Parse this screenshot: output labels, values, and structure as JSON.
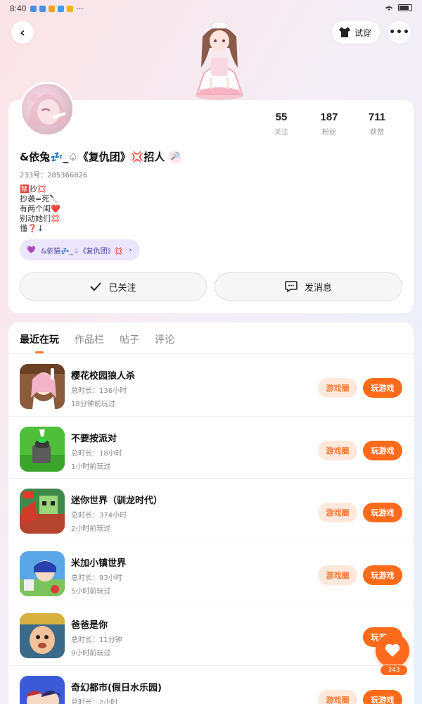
{
  "status_bar": {
    "time": "8:40",
    "more": "···"
  },
  "topbar": {
    "back_icon": "‹",
    "try_on_label": "试穿",
    "more_label": "•••"
  },
  "profile": {
    "stats": [
      {
        "value": "55",
        "label": "关注"
      },
      {
        "value": "187",
        "label": "粉丝"
      },
      {
        "value": "711",
        "label": "获赞"
      }
    ],
    "nickname": "&依兔💤_♤《复仇团》💢招人",
    "search_icon": "🔎",
    "uid": "233号：285366826",
    "bio": "🈲抄💢\n抄袭=死🔪\n有两个闺❤️\n别动她们💢\n懂❓↓",
    "group_tag": "&依猫💤_♤《复仇团》💢",
    "group_icon": "💜",
    "group_chevron": "›",
    "follow_label": "已关注",
    "message_label": "发消息"
  },
  "tabs": [
    "最近在玩",
    "作品栏",
    "帖子",
    "评论"
  ],
  "games": [
    {
      "name": "樱花校园狼人杀",
      "duration": "总时长：136小时",
      "last_played": "18分钟前玩过",
      "circle_label": "游戏圈",
      "play_label": "玩游戏"
    },
    {
      "name": "不要按派对",
      "duration": "总时长：18小时",
      "last_played": "1小时前玩过",
      "circle_label": "游戏圈",
      "play_label": "玩游戏"
    },
    {
      "name": "迷你世界（驯龙时代）",
      "duration": "总时长：374小时",
      "last_played": "2小时前玩过",
      "circle_label": "游戏圈",
      "play_label": "玩游戏"
    },
    {
      "name": "米加小镇世界",
      "duration": "总时长：93小时",
      "last_played": "5小时前玩过",
      "circle_label": "游戏圈",
      "play_label": "玩游戏"
    },
    {
      "name": "爸爸是你",
      "duration": "总时长：11分钟",
      "last_played": "9小时前玩过",
      "circle_label": "",
      "play_label": "玩游戏"
    },
    {
      "name": "奇幻都市(假日水乐园)",
      "duration": "总时长：2小时",
      "last_played": "",
      "circle_label": "游戏圈",
      "play_label": "玩游戏"
    }
  ],
  "fab": {
    "count": "343"
  },
  "colors": {
    "accent": "#ff6b1a",
    "accent_light": "#fde9dc",
    "tag_bg": "#ebe6fb"
  }
}
